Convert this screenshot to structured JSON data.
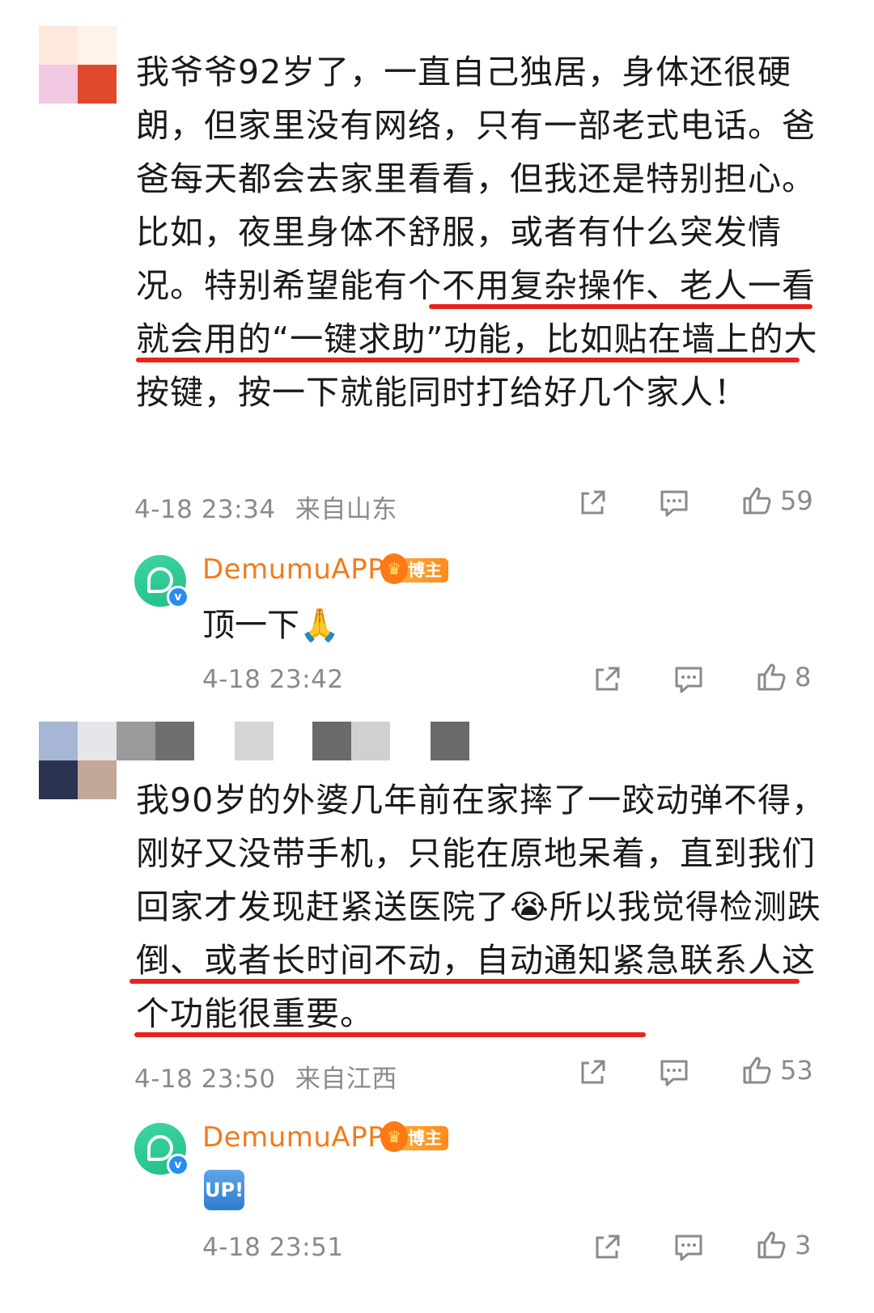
{
  "comments": [
    {
      "text": "我爷爷92岁了，一直自己独居，身体还很硬朗，但家里没有网络，只有一部老式电话。爸爸每天都会去家里看看，但我还是特别担心。 比如，夜里身体不舒服，或者有什么突发情况。特别希望能有个不用复杂操作、老人一看就会用的“一键求助”功能，比如贴在墙上的大按键，按一下就能同时打给好几个家人！",
      "time": "4-18 23:34",
      "location": "来自山东",
      "likes": "59",
      "reply": {
        "name": "DemumuAPP",
        "badge": "博主",
        "text": "顶一下🙏",
        "time": "4-18 23:42",
        "likes": "8"
      }
    },
    {
      "text": "我90岁的外婆几年前在家摔了一跤动弹不得，刚好又没带手机，只能在原地呆着，直到我们回家才发现赶紧送医院了😭所以我觉得检测跌倒、或者长时间不动，自动通知紧急联系人这个功能很重要。",
      "time": "4-18 23:50",
      "location": "来自江西",
      "likes": "53",
      "reply": {
        "name": "DemumuAPP",
        "badge": "博主",
        "emoji": "UP!",
        "time": "4-18 23:51",
        "likes": "3"
      }
    }
  ],
  "colors": {
    "underline": "#e8231a",
    "name": "#f07c1e",
    "meta": "#8a8a8a"
  }
}
